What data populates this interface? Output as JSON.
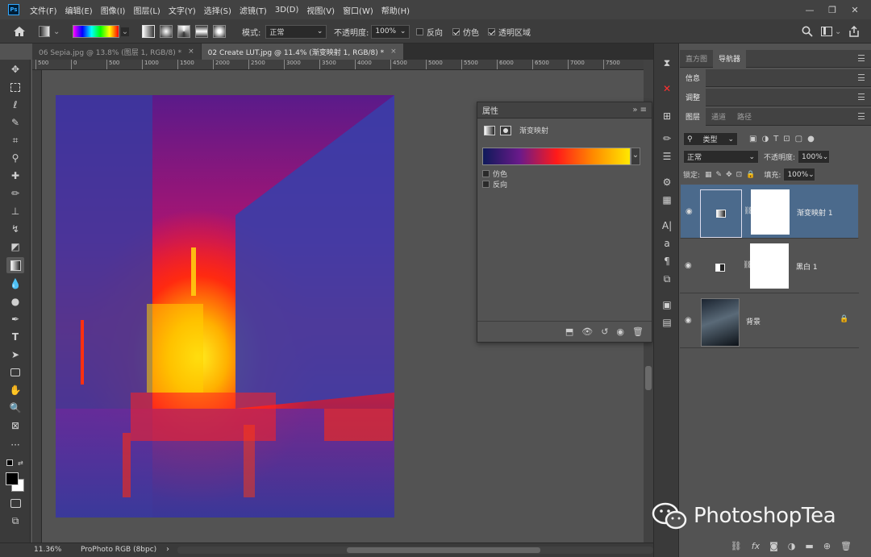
{
  "menubar": {
    "logo": "Ps",
    "items": [
      "文件(F)",
      "编辑(E)",
      "图像(I)",
      "图层(L)",
      "文字(Y)",
      "选择(S)",
      "滤镜(T)",
      "3D(D)",
      "视图(V)",
      "窗口(W)",
      "帮助(H)"
    ]
  },
  "options": {
    "mode_label": "模式:",
    "mode_value": "正常",
    "opacity_label": "不透明度:",
    "opacity_value": "100%",
    "reverse_label": "反向",
    "dither_label": "仿色",
    "transparency_label": "透明区域"
  },
  "tabs": [
    {
      "label": "06 Sepia.jpg @ 13.8% (图层 1, RGB/8) *",
      "close": "×"
    },
    {
      "label": "02 Create LUT.jpg @ 11.4% (渐变映射 1, RGB/8) *",
      "close": "×"
    }
  ],
  "ruler_ticks": [
    "500",
    "0",
    "500",
    "1000",
    "1500",
    "2000",
    "2500",
    "3000",
    "3500",
    "4000",
    "4500",
    "5000",
    "5500",
    "6000",
    "6500",
    "7000",
    "7500"
  ],
  "status": {
    "zoom": "11.36%",
    "profile": "ProPhoto RGB (8bpc)",
    "arrow": "›"
  },
  "properties": {
    "title": "属性",
    "adjustment_name": "渐变映射",
    "dither_label": "仿色",
    "reverse_label": "反向"
  },
  "panels": {
    "row1_tabs": [
      "直方图",
      "导航器"
    ],
    "row2_tabs": [
      "信息"
    ],
    "row3_tabs": [
      "调整"
    ],
    "layers_tabs": [
      "图层",
      "通道",
      "路径"
    ],
    "filter_kind": "类型",
    "blend_mode": "正常",
    "opacity_label": "不透明度:",
    "opacity_value": "100%",
    "lock_label": "锁定:",
    "fill_label": "填充:",
    "fill_value": "100%",
    "layers": [
      {
        "name": "渐变映射 1",
        "selected": true
      },
      {
        "name": "黑白 1",
        "selected": false
      },
      {
        "name": "背景",
        "selected": false
      }
    ]
  },
  "watermark": {
    "text": "PhotoshopTea"
  },
  "colors": {
    "accent": "#31a8ff",
    "selected_layer": "#4b6a8c",
    "gradient": [
      "#1a1f6b",
      "#8a1a8c",
      "#ff1a1a",
      "#ff8a00",
      "#ffe800"
    ]
  }
}
